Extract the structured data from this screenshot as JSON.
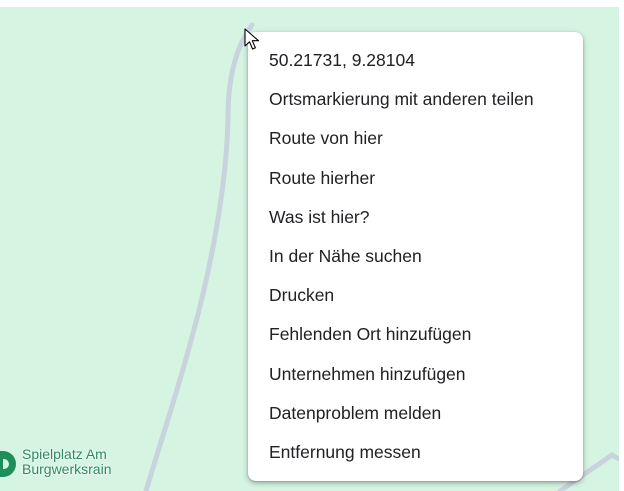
{
  "map": {
    "background_color": "#d5f4e2",
    "path_color": "#c9d3de",
    "poi": {
      "icon": "park-pin-icon",
      "color": "#1e8e5a",
      "label_lines": [
        "Spielplatz Am",
        "Burgwerksrain"
      ]
    }
  },
  "context_menu": {
    "coordinates": "50.21731, 9.28104",
    "items": [
      "Ortsmarkierung mit anderen teilen",
      "Route von hier",
      "Route hierher",
      "Was ist hier?",
      "In der Nähe suchen",
      "Drucken",
      "Fehlenden Ort hinzufügen",
      "Unternehmen hinzufügen",
      "Datenproblem melden",
      "Entfernung messen"
    ]
  },
  "cursor": {
    "icon": "mouse-pointer-icon"
  }
}
